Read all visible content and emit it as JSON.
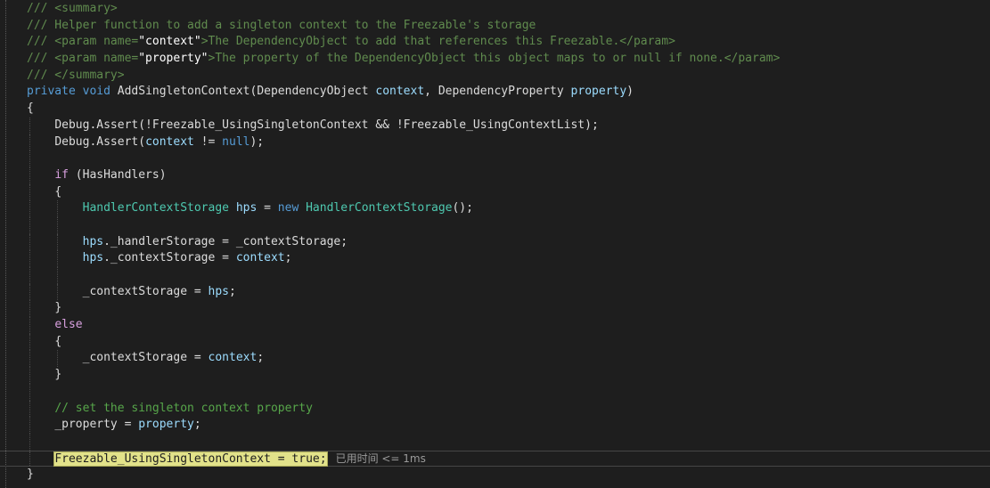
{
  "code": {
    "doc_summary_open": "/// <summary>",
    "doc_helper": "/// Helper function to add a singleton context to the Freezable's storage",
    "doc_param1_prefix": "/// <param name=",
    "doc_param1_name": "\"context\"",
    "doc_param1_desc": ">The DependencyObject to add that references this Freezable.</param>",
    "doc_param2_prefix": "/// <param name=",
    "doc_param2_name": "\"property\"",
    "doc_param2_desc": ">The property of the DependencyObject this object maps to or null if none.</param>",
    "doc_summary_close": "/// </summary>",
    "sig_private": "private",
    "sig_void": "void",
    "sig_method": "AddSingletonContext",
    "sig_type1": "DependencyObject",
    "sig_param1": "context",
    "sig_type2": "DependencyProperty",
    "sig_param2": "property",
    "brace_open": "{",
    "brace_close": "}",
    "assert1": "Debug.Assert(!Freezable_UsingSingletonContext && !Freezable_UsingContextList);",
    "assert2_prefix": "Debug.Assert(",
    "assert2_var": "context",
    "assert2_op": " != ",
    "assert2_null": "null",
    "assert2_suffix": ");",
    "if_kw": "if",
    "if_cond": " (HasHandlers)",
    "hcs_type": "HandlerContextStorage",
    "hcs_var": "hps",
    "hcs_assign": " = ",
    "hcs_new": "new",
    "hcs_ctor": "HandlerContextStorage",
    "hcs_end": "();",
    "hps_var": "hps",
    "handler_storage_member": "._handlerStorage = _contextStorage;",
    "context_storage_member": "._contextStorage = ",
    "context_var": "context",
    "semicolon": ";",
    "cs_assign": "_contextStorage = ",
    "cs_hps": "hps",
    "else_kw": "else",
    "comment_set": "// set the singleton context property",
    "prop_assign": "_property = ",
    "prop_var": "property",
    "highlighted_stmt": "Freezable_UsingSingletonContext = true;",
    "perf_tip": "已用时间 <= 1ms"
  }
}
